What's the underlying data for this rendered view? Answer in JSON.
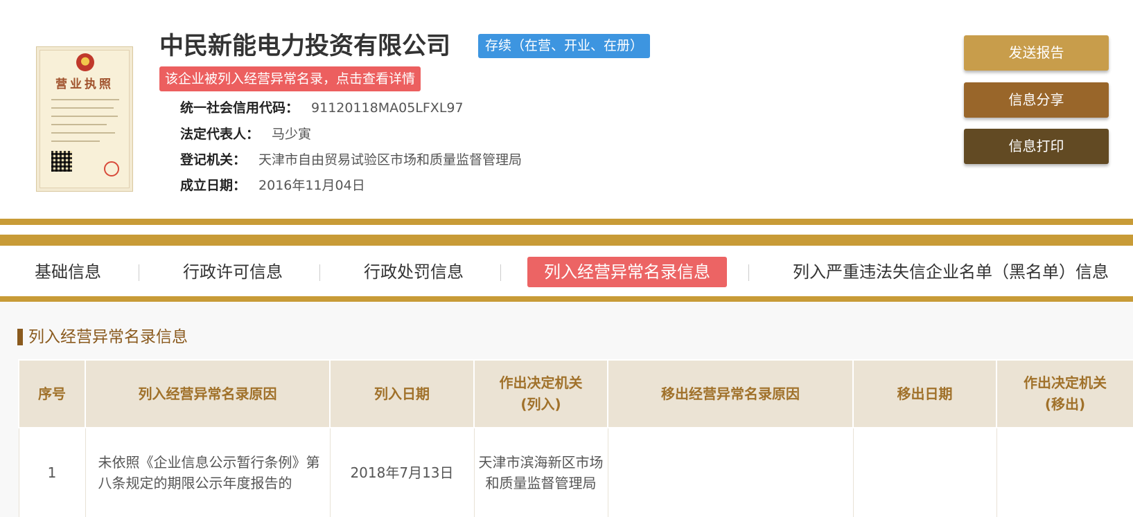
{
  "header": {
    "license_image": {
      "title": "营业执照"
    },
    "company_name": "中民新能电力投资有限公司",
    "status": "存续（在营、开业、在册）",
    "abnormal_alert": "该企业被列入经营异常名录，点击查看详情",
    "fields": [
      {
        "label": "统一社会信用代码：",
        "value": "91120118MA05LFXL97"
      },
      {
        "label": "法定代表人：",
        "value": "马少寅"
      },
      {
        "label": "登记机关：",
        "value": "天津市自由贸易试验区市场和质量监督管理局"
      },
      {
        "label": "成立日期：",
        "value": "2016年11月04日"
      }
    ],
    "actions": {
      "send": "发送报告",
      "share": "信息分享",
      "print": "信息打印"
    }
  },
  "tabs": [
    {
      "label": "基础信息"
    },
    {
      "label": "行政许可信息"
    },
    {
      "label": "行政处罚信息"
    },
    {
      "label": "列入经营异常名录信息",
      "active": true
    },
    {
      "label": "列入严重违法失信企业名单（黑名单）信息"
    }
  ],
  "section": {
    "title": "列入经营异常名录信息",
    "columns": [
      "序号",
      "列入经营异常名录原因",
      "列入日期",
      "作出决定机关(列入)",
      "移出经营异常名录原因",
      "移出日期",
      "作出决定机关(移出)"
    ],
    "column_lines": [
      [
        "序号"
      ],
      [
        "列入经营异常名录原因"
      ],
      [
        "列入日期"
      ],
      [
        "作出决定机关",
        "(列入)"
      ],
      [
        "移出经营异常名录原因"
      ],
      [
        "移出日期"
      ],
      [
        "作出决定机关",
        "(移出)"
      ]
    ],
    "rows": [
      {
        "index": "1",
        "reason": "未依照《企业信息公示暂行条例》第八条规定的期限公示年度报告的",
        "date": "2018年7月13日",
        "authority": "天津市滨海新区市场和质量监督管理局",
        "removal_reason": "",
        "removal_date": "",
        "removal_authority": ""
      }
    ]
  },
  "colors": {
    "gold": "#c89b37",
    "brown_title": "#8a5a1e",
    "tab_active": "#ec6464",
    "status_blue": "#3d95e0",
    "alert_red": "#ec5f5f"
  }
}
